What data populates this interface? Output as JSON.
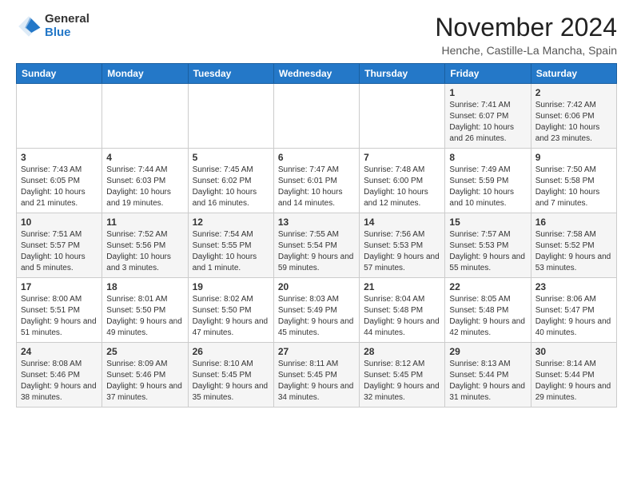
{
  "header": {
    "logo_general": "General",
    "logo_blue": "Blue",
    "month_title": "November 2024",
    "subtitle": "Henche, Castille-La Mancha, Spain"
  },
  "weekdays": [
    "Sunday",
    "Monday",
    "Tuesday",
    "Wednesday",
    "Thursday",
    "Friday",
    "Saturday"
  ],
  "weeks": [
    [
      {
        "day": "",
        "info": ""
      },
      {
        "day": "",
        "info": ""
      },
      {
        "day": "",
        "info": ""
      },
      {
        "day": "",
        "info": ""
      },
      {
        "day": "",
        "info": ""
      },
      {
        "day": "1",
        "info": "Sunrise: 7:41 AM\nSunset: 6:07 PM\nDaylight: 10 hours and 26 minutes."
      },
      {
        "day": "2",
        "info": "Sunrise: 7:42 AM\nSunset: 6:06 PM\nDaylight: 10 hours and 23 minutes."
      }
    ],
    [
      {
        "day": "3",
        "info": "Sunrise: 7:43 AM\nSunset: 6:05 PM\nDaylight: 10 hours and 21 minutes."
      },
      {
        "day": "4",
        "info": "Sunrise: 7:44 AM\nSunset: 6:03 PM\nDaylight: 10 hours and 19 minutes."
      },
      {
        "day": "5",
        "info": "Sunrise: 7:45 AM\nSunset: 6:02 PM\nDaylight: 10 hours and 16 minutes."
      },
      {
        "day": "6",
        "info": "Sunrise: 7:47 AM\nSunset: 6:01 PM\nDaylight: 10 hours and 14 minutes."
      },
      {
        "day": "7",
        "info": "Sunrise: 7:48 AM\nSunset: 6:00 PM\nDaylight: 10 hours and 12 minutes."
      },
      {
        "day": "8",
        "info": "Sunrise: 7:49 AM\nSunset: 5:59 PM\nDaylight: 10 hours and 10 minutes."
      },
      {
        "day": "9",
        "info": "Sunrise: 7:50 AM\nSunset: 5:58 PM\nDaylight: 10 hours and 7 minutes."
      }
    ],
    [
      {
        "day": "10",
        "info": "Sunrise: 7:51 AM\nSunset: 5:57 PM\nDaylight: 10 hours and 5 minutes."
      },
      {
        "day": "11",
        "info": "Sunrise: 7:52 AM\nSunset: 5:56 PM\nDaylight: 10 hours and 3 minutes."
      },
      {
        "day": "12",
        "info": "Sunrise: 7:54 AM\nSunset: 5:55 PM\nDaylight: 10 hours and 1 minute."
      },
      {
        "day": "13",
        "info": "Sunrise: 7:55 AM\nSunset: 5:54 PM\nDaylight: 9 hours and 59 minutes."
      },
      {
        "day": "14",
        "info": "Sunrise: 7:56 AM\nSunset: 5:53 PM\nDaylight: 9 hours and 57 minutes."
      },
      {
        "day": "15",
        "info": "Sunrise: 7:57 AM\nSunset: 5:53 PM\nDaylight: 9 hours and 55 minutes."
      },
      {
        "day": "16",
        "info": "Sunrise: 7:58 AM\nSunset: 5:52 PM\nDaylight: 9 hours and 53 minutes."
      }
    ],
    [
      {
        "day": "17",
        "info": "Sunrise: 8:00 AM\nSunset: 5:51 PM\nDaylight: 9 hours and 51 minutes."
      },
      {
        "day": "18",
        "info": "Sunrise: 8:01 AM\nSunset: 5:50 PM\nDaylight: 9 hours and 49 minutes."
      },
      {
        "day": "19",
        "info": "Sunrise: 8:02 AM\nSunset: 5:50 PM\nDaylight: 9 hours and 47 minutes."
      },
      {
        "day": "20",
        "info": "Sunrise: 8:03 AM\nSunset: 5:49 PM\nDaylight: 9 hours and 45 minutes."
      },
      {
        "day": "21",
        "info": "Sunrise: 8:04 AM\nSunset: 5:48 PM\nDaylight: 9 hours and 44 minutes."
      },
      {
        "day": "22",
        "info": "Sunrise: 8:05 AM\nSunset: 5:48 PM\nDaylight: 9 hours and 42 minutes."
      },
      {
        "day": "23",
        "info": "Sunrise: 8:06 AM\nSunset: 5:47 PM\nDaylight: 9 hours and 40 minutes."
      }
    ],
    [
      {
        "day": "24",
        "info": "Sunrise: 8:08 AM\nSunset: 5:46 PM\nDaylight: 9 hours and 38 minutes."
      },
      {
        "day": "25",
        "info": "Sunrise: 8:09 AM\nSunset: 5:46 PM\nDaylight: 9 hours and 37 minutes."
      },
      {
        "day": "26",
        "info": "Sunrise: 8:10 AM\nSunset: 5:45 PM\nDaylight: 9 hours and 35 minutes."
      },
      {
        "day": "27",
        "info": "Sunrise: 8:11 AM\nSunset: 5:45 PM\nDaylight: 9 hours and 34 minutes."
      },
      {
        "day": "28",
        "info": "Sunrise: 8:12 AM\nSunset: 5:45 PM\nDaylight: 9 hours and 32 minutes."
      },
      {
        "day": "29",
        "info": "Sunrise: 8:13 AM\nSunset: 5:44 PM\nDaylight: 9 hours and 31 minutes."
      },
      {
        "day": "30",
        "info": "Sunrise: 8:14 AM\nSunset: 5:44 PM\nDaylight: 9 hours and 29 minutes."
      }
    ]
  ]
}
